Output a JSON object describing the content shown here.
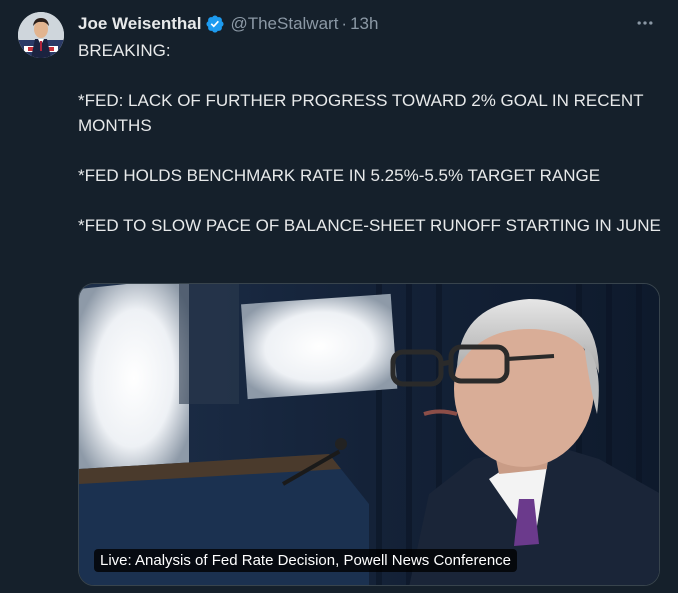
{
  "tweet": {
    "display_name": "Joe Weisenthal",
    "handle": "@TheStalwart",
    "separator": "·",
    "time": "13h",
    "verified": true,
    "lines": [
      "BREAKING:",
      "*FED: LACK OF FURTHER PROGRESS TOWARD 2% GOAL IN RECENT MONTHS",
      "*FED HOLDS BENCHMARK RATE IN 5.25%-5.5% TARGET RANGE",
      "*FED TO SLOW PACE OF BALANCE-SHEET RUNOFF STARTING IN JUNE"
    ],
    "media": {
      "caption": "Live: Analysis of Fed Rate Decision, Powell News Conference"
    }
  },
  "colors": {
    "background": "#15202b",
    "text": "#e7e9ea",
    "secondary": "#8b98a5",
    "verified": "#1d9bf0"
  },
  "icons": {
    "verified": "verified-badge-icon",
    "more": "more-options-icon"
  }
}
